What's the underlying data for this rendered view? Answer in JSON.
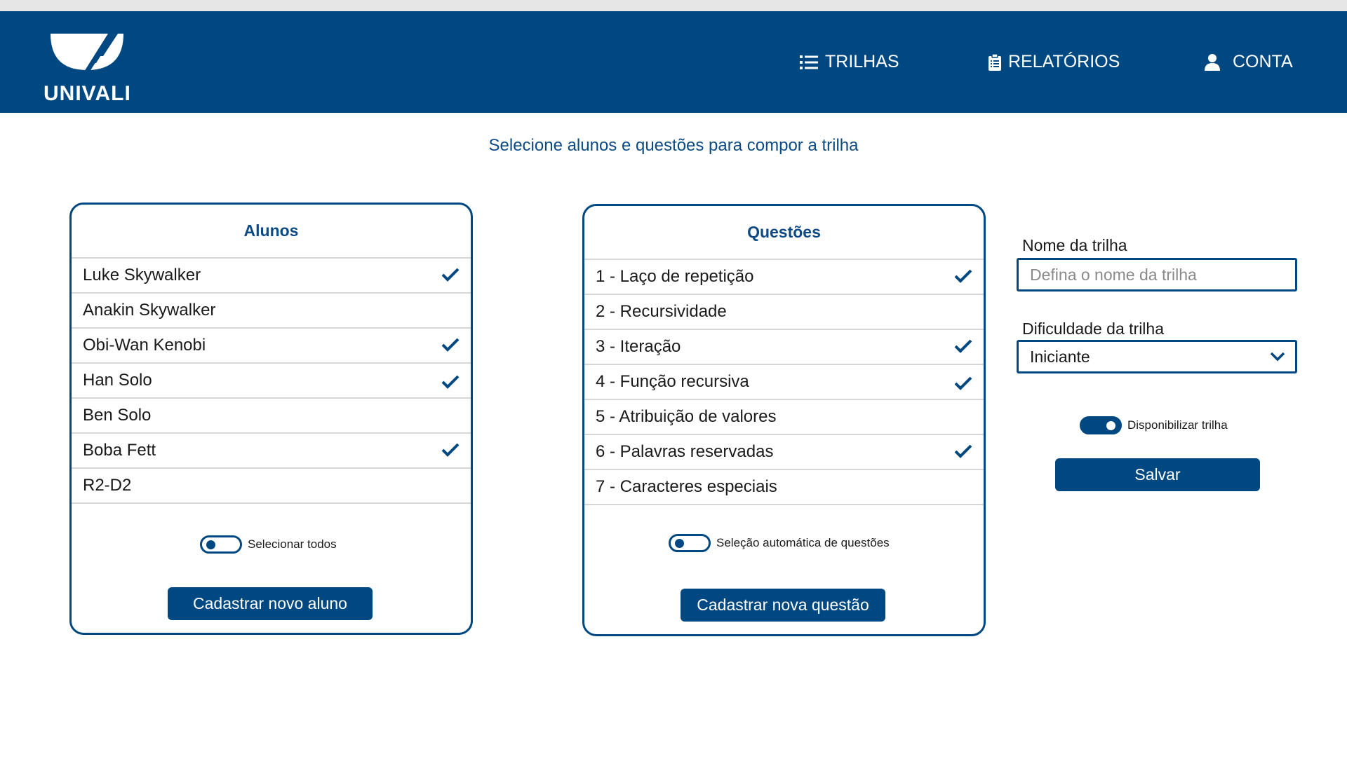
{
  "brand": {
    "name": "UNIVALI"
  },
  "nav": [
    {
      "label": "TRILHAS",
      "icon": "list-icon"
    },
    {
      "label": "RELATÓRIOS",
      "icon": "clipboard-icon"
    },
    {
      "label": "CONTA",
      "icon": "user-icon"
    }
  ],
  "subtitle": "Selecione alunos e questões para compor a trilha",
  "students": {
    "title": "Alunos",
    "items": [
      {
        "name": "Luke Skywalker",
        "selected": true
      },
      {
        "name": "Anakin Skywalker",
        "selected": false
      },
      {
        "name": "Obi-Wan Kenobi",
        "selected": true
      },
      {
        "name": "Han Solo",
        "selected": true
      },
      {
        "name": "Ben Solo",
        "selected": false
      },
      {
        "name": "Boba Fett",
        "selected": true
      },
      {
        "name": "R2-D2",
        "selected": false
      }
    ],
    "toggle_label": "Selecionar todos",
    "toggle_on": false,
    "button_label": "Cadastrar novo aluno"
  },
  "questions": {
    "title": "Questões",
    "items": [
      {
        "name": "1 - Laço de repetição",
        "selected": true
      },
      {
        "name": "2 - Recursividade",
        "selected": false
      },
      {
        "name": "3 - Iteração",
        "selected": true
      },
      {
        "name": "4 - Função recursiva",
        "selected": true
      },
      {
        "name": "5 - Atribuição de valores",
        "selected": false
      },
      {
        "name": "6 - Palavras reservadas",
        "selected": true
      },
      {
        "name": "7 - Caracteres especiais",
        "selected": false
      }
    ],
    "toggle_label": "Seleção automática de questões",
    "toggle_on": false,
    "button_label": "Cadastrar nova questão"
  },
  "form": {
    "name_label": "Nome da trilha",
    "name_placeholder": "Defina o nome da trilha",
    "name_value": "",
    "difficulty_label": "Dificuldade da trilha",
    "difficulty_value": "Iniciante",
    "publish_label": "Disponibilizar trilha",
    "publish_on": true,
    "save_label": "Salvar"
  },
  "colors": {
    "primary": "#004881",
    "divider": "#d6d6d6",
    "subtitle": "#0b4a84"
  }
}
